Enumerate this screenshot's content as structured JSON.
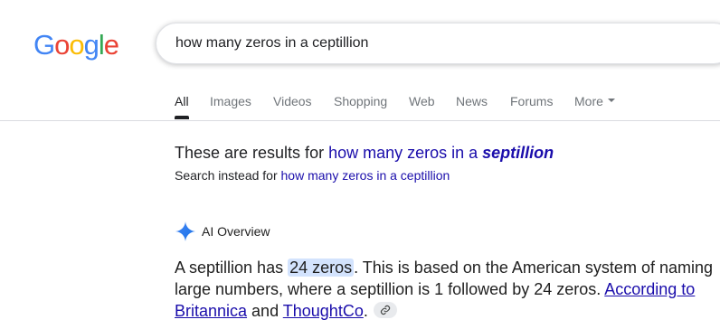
{
  "logo": {
    "letters": [
      "G",
      "o",
      "o",
      "g",
      "l",
      "e"
    ],
    "colors": [
      "#4285f4",
      "#ea4335",
      "#fbbc05",
      "#4285f4",
      "#34a853",
      "#ea4335"
    ]
  },
  "search": {
    "query": "how many zeros in a ceptillion"
  },
  "tabs": [
    {
      "label": "All",
      "active": true
    },
    {
      "label": "Images"
    },
    {
      "label": "Videos"
    },
    {
      "label": "Shopping"
    },
    {
      "label": "Web"
    },
    {
      "label": "News"
    },
    {
      "label": "Forums"
    },
    {
      "label": "More",
      "icon": "caret-down-icon"
    }
  ],
  "correction": {
    "prefix": "These are results for ",
    "link_plain": "how many zeros in a ",
    "link_bold": "septillion",
    "instead_prefix": "Search instead for ",
    "instead_link": "how many zeros in a ceptillion"
  },
  "ai_overview": {
    "icon": "sparkle-icon",
    "title": "AI Overview",
    "text_1": "A septillion has ",
    "highlight": "24 zeros",
    "text_2": ". This is based on the American system of naming large numbers, where a septillion is 1 followed by 24 zeros. ",
    "link_1": "According to Britannica",
    "text_3": " and ",
    "link_2": "ThoughtCo",
    "text_4": ".",
    "chip_icon": "link-icon"
  },
  "colors": {
    "link": "#1a0dab",
    "highlight": "#d3e3fd",
    "accent_blue": "#4285f4"
  }
}
